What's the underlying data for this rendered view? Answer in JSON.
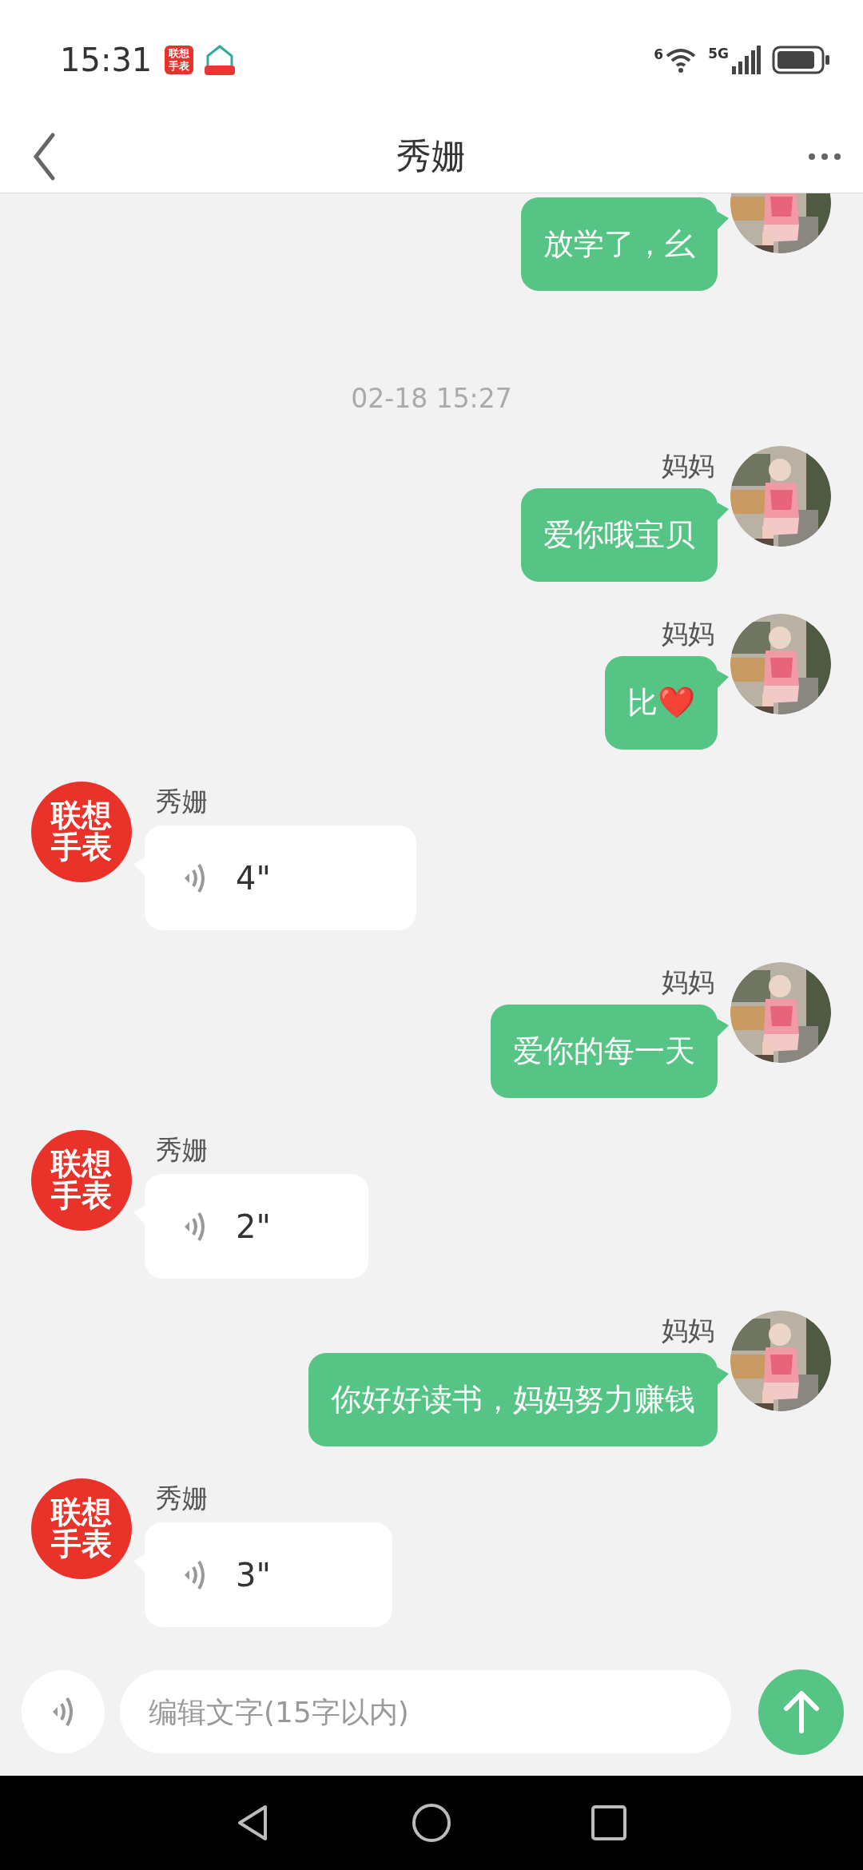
{
  "status_bar": {
    "time": "15:31",
    "app_icon_text": "联想手表",
    "wifi_label": "6",
    "network_label": "5G"
  },
  "header": {
    "title": "秀姗"
  },
  "messages": [
    {
      "kind": "text",
      "outgoing": true,
      "text": "放学了，幺"
    },
    {
      "kind": "timestamp",
      "text": "02-18 15:27"
    },
    {
      "kind": "text",
      "outgoing": true,
      "sender": "妈妈",
      "text": "爱你哦宝贝"
    },
    {
      "kind": "text",
      "outgoing": true,
      "sender": "妈妈",
      "text": "比❤️"
    },
    {
      "kind": "voice",
      "outgoing": false,
      "sender": "秀姗",
      "avatar_text": "联想手表",
      "duration": "4\""
    },
    {
      "kind": "text",
      "outgoing": true,
      "sender": "妈妈",
      "text": "爱你的每一天"
    },
    {
      "kind": "voice",
      "outgoing": false,
      "sender": "秀姗",
      "avatar_text": "联想手表",
      "duration": "2\""
    },
    {
      "kind": "text",
      "outgoing": true,
      "sender": "妈妈",
      "text": "你好好读书，妈妈努力赚钱"
    },
    {
      "kind": "voice",
      "outgoing": false,
      "sender": "秀姗",
      "avatar_text": "联想手表",
      "duration": "3\""
    }
  ],
  "input_bar": {
    "placeholder": "编辑文字(15字以内)"
  }
}
